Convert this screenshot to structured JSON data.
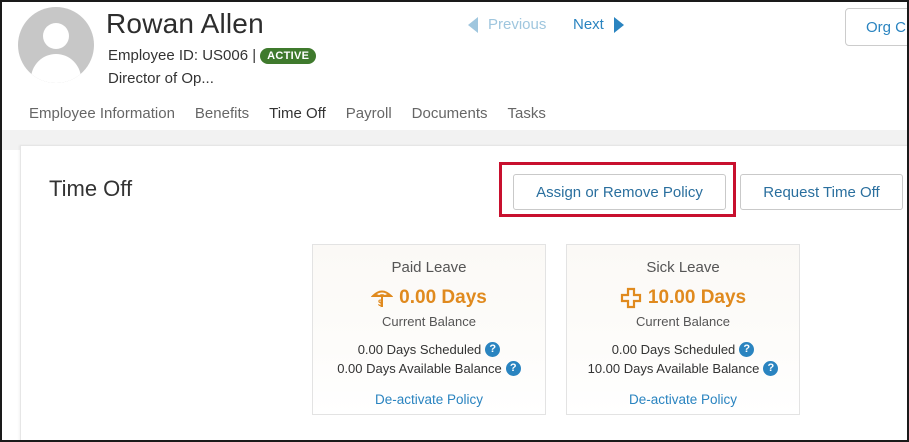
{
  "employee": {
    "name": "Rowan Allen",
    "id_text": "Employee ID: US006 |",
    "status": "ACTIVE",
    "title": "Director of Op..."
  },
  "pager": {
    "previous": "Previous",
    "next": "Next"
  },
  "org_button": "Org C",
  "tabs": [
    {
      "label": "Employee Information"
    },
    {
      "label": "Benefits"
    },
    {
      "label": "Time Off",
      "active": true
    },
    {
      "label": "Payroll"
    },
    {
      "label": "Documents"
    },
    {
      "label": "Tasks"
    }
  ],
  "section": {
    "title": "Time Off",
    "assign_button": "Assign or Remove Policy",
    "request_button": "Request Time Off"
  },
  "cards": [
    {
      "title": "Paid Leave",
      "icon": "beach-umbrella-icon",
      "balance": "0.00 Days",
      "balance_label": "Current Balance",
      "scheduled": "0.00 Days Scheduled",
      "available": "0.00 Days Available Balance",
      "link": "De-activate Policy"
    },
    {
      "title": "Sick Leave",
      "icon": "medical-cross-icon",
      "balance": "10.00 Days",
      "balance_label": "Current Balance",
      "scheduled": "0.00 Days Scheduled",
      "available": "10.00 Days Available Balance",
      "link": "De-activate Policy"
    }
  ],
  "colors": {
    "accent": "#e08a1e",
    "link": "#2a84c0",
    "active_badge": "#3f7a2d",
    "highlight": "#c8102e"
  }
}
